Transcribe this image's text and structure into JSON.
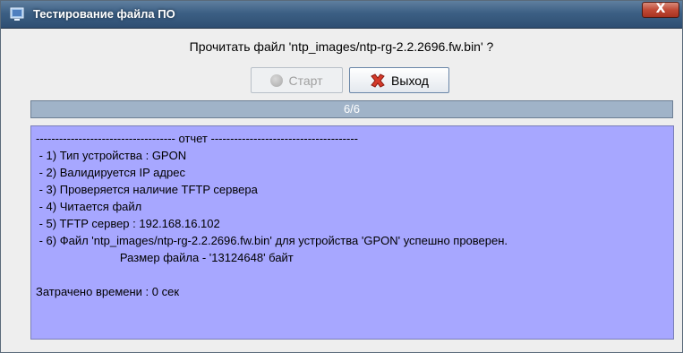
{
  "window": {
    "title": "Тестирование файла ПО",
    "close_label": "X"
  },
  "dialog": {
    "prompt": "Прочитать файл 'ntp_images/ntp-rg-2.2.2696.fw.bin' ?",
    "start_label": "Старт",
    "exit_label": "Выход",
    "progress_text": "6/6",
    "progress_fraction": 1.0
  },
  "report": {
    "lines": [
      "------------------------------------ отчет --------------------------------------",
      " - 1) Тип устройства : GPON",
      " - 2) Валидируется IP адрес",
      " - 3) Проверяется наличие TFTP сервера",
      " - 4) Читается файл",
      " - 5) TFTP сервер : 192.168.16.102",
      " - 6) Файл 'ntp_images/ntp-rg-2.2.2696.fw.bin' для устройства 'GPON' успешно проверен.",
      "                          Размер файла - '13124648' байт",
      "",
      "Затрачено времени : 0 сек"
    ]
  },
  "colors": {
    "titlebar": "#3c5f84",
    "progress": "#a0b3c8",
    "report_bg": "#a7a7ff"
  }
}
